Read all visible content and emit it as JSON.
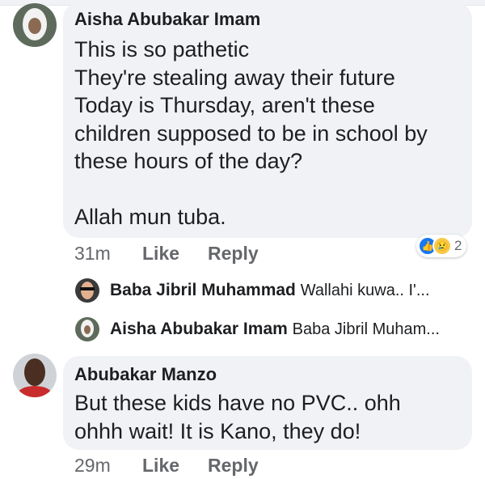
{
  "comments": [
    {
      "author": "Aisha Abubakar Imam",
      "lines": [
        "This is so pathetic",
        "They're stealing away their future",
        "Today is Thursday, aren't these",
        "children supposed to be in school by",
        "these hours of the day?",
        "",
        "Allah mun tuba."
      ],
      "time": "31m",
      "like_label": "Like",
      "reply_label": "Reply",
      "reactions": {
        "icons": [
          "like-icon",
          "sad-icon"
        ],
        "count": "2",
        "like_color": "#1877f2",
        "sad_color": "#f7c948"
      },
      "replies": [
        {
          "author": "Baba Jibril Muhammad",
          "preview": "Wallahi kuwa.. I'..."
        },
        {
          "author": "Aisha Abubakar Imam",
          "preview": "Baba Jibril Muham..."
        }
      ]
    },
    {
      "author": "Abubakar Manzo",
      "lines": [
        "But these kids have no PVC..  ohh",
        "ohhh wait! It is Kano, they do!"
      ],
      "time": "29m",
      "like_label": "Like",
      "reply_label": "Reply"
    }
  ],
  "colors": {
    "bubble": "#f0f2f5",
    "meta": "#65676b",
    "text": "#1c1e21"
  }
}
